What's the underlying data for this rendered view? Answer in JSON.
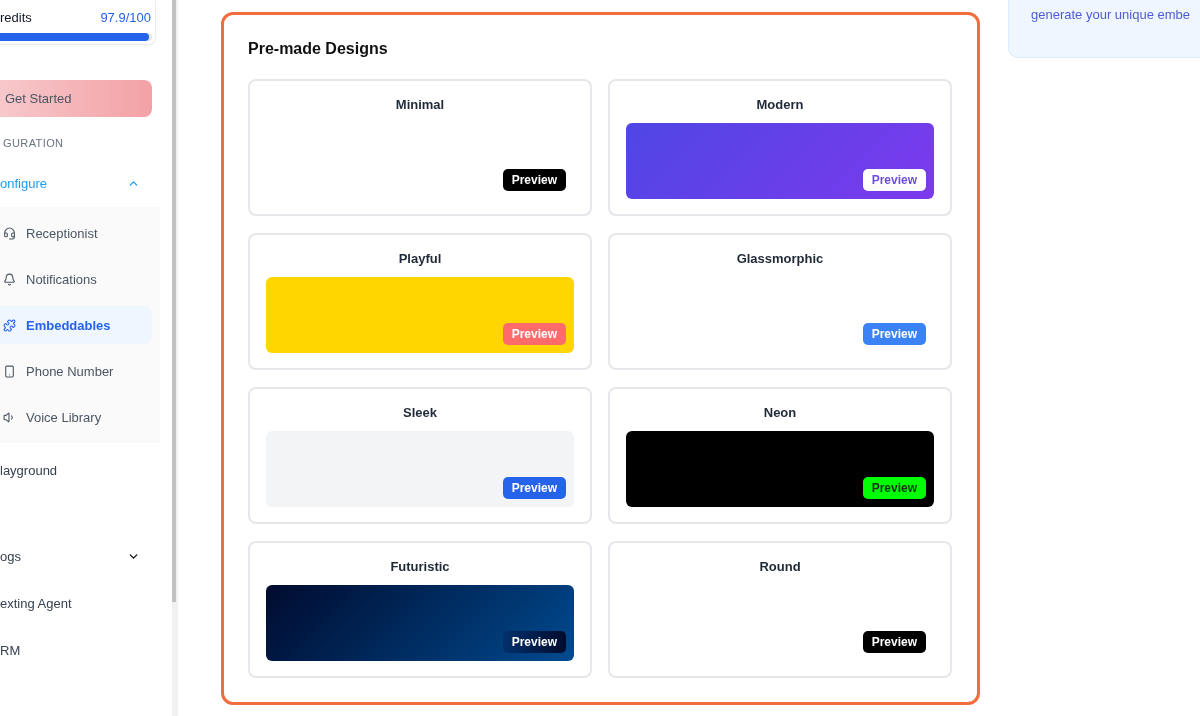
{
  "sidebar": {
    "credits": {
      "label": "redits",
      "value": "97.9/100",
      "level": 0.979
    },
    "get_started": "Get Started",
    "section_label": "GURATION",
    "nav": [
      {
        "label": "onfigure",
        "kind": "group",
        "selected": true,
        "expanded": true,
        "children": [
          {
            "label": "Receptionist",
            "selected": false
          },
          {
            "label": "Notifications",
            "selected": false
          },
          {
            "label": "Embeddables",
            "selected": true
          },
          {
            "label": "Phone Number",
            "selected": false
          },
          {
            "label": "Voice Library",
            "selected": false
          }
        ]
      },
      {
        "label": "layground",
        "kind": "link",
        "selected": false
      },
      {
        "label": "ogs",
        "kind": "group",
        "selected": false,
        "expanded": false
      },
      {
        "label": "exting Agent",
        "kind": "link",
        "selected": false
      },
      {
        "label": "RM",
        "kind": "link",
        "selected": false
      }
    ]
  },
  "designs": {
    "title": "Pre-made Designs",
    "items": [
      {
        "name": "Minimal",
        "kind": "minimal",
        "button": "Preview"
      },
      {
        "name": "Modern",
        "kind": "modern",
        "button": "Preview"
      },
      {
        "name": "Playful",
        "kind": "playful",
        "button": "Preview"
      },
      {
        "name": "Glassmorphic",
        "kind": "glassmorphic",
        "button": "Preview"
      },
      {
        "name": "Sleek",
        "kind": "sleek",
        "button": "Preview"
      },
      {
        "name": "Neon",
        "kind": "neon",
        "button": "Preview"
      },
      {
        "name": "Futuristic",
        "kind": "futuristic",
        "button": "Preview"
      },
      {
        "name": "Round",
        "kind": "round",
        "button": "Preview"
      }
    ]
  },
  "info": {
    "text": "generate your unique embe"
  }
}
